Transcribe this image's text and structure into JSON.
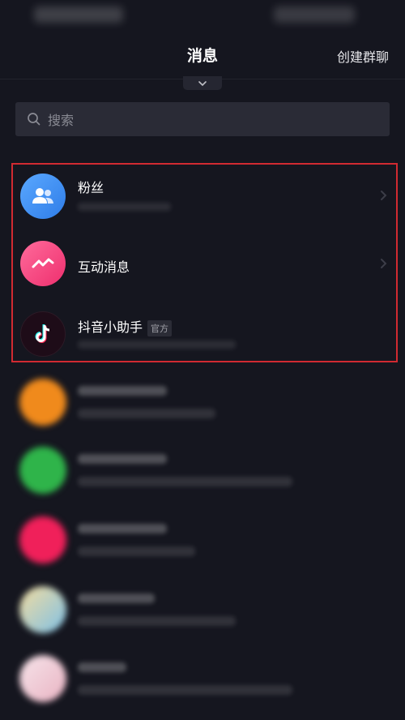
{
  "nav": {
    "title": "消息",
    "action": "创建群聊"
  },
  "search": {
    "placeholder": "搜索"
  },
  "highlighted_rows": [
    {
      "title": "粉丝",
      "icon": "fans-icon",
      "color": "#3f8ff3"
    },
    {
      "title": "互动消息",
      "icon": "interaction-icon",
      "color": "#f2427d"
    },
    {
      "title": "抖音小助手",
      "tag": "官方",
      "icon": "tiktok-logo-icon",
      "color": "#1e0c18"
    }
  ],
  "colors": {
    "background": "#15161f",
    "highlight": "#d12a31"
  }
}
